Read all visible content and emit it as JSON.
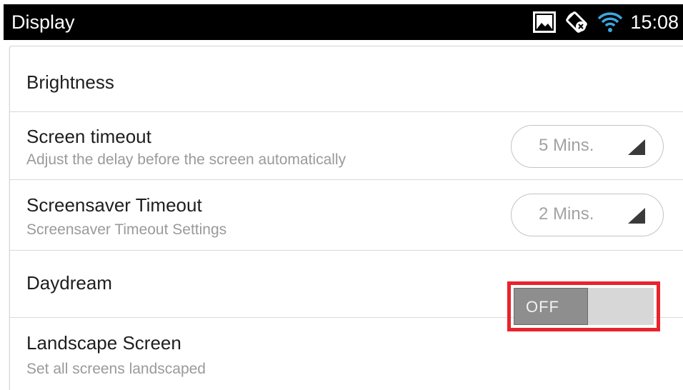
{
  "status_bar": {
    "title": "Display",
    "time": "15:08",
    "icons": [
      "image-notification-icon",
      "auto-rotate-off-icon",
      "wifi-icon"
    ]
  },
  "settings": {
    "brightness": {
      "title": "Brightness"
    },
    "screen_timeout": {
      "title": "Screen timeout",
      "subtitle": "Adjust the delay before the screen automatically",
      "value": "5 Mins."
    },
    "screensaver_timeout": {
      "title": "Screensaver Timeout",
      "subtitle": "Screensaver Timeout Settings",
      "value": "2 Mins."
    },
    "daydream": {
      "title": "Daydream"
    },
    "landscape_screen": {
      "title": "Landscape Screen",
      "subtitle": "Set all screens landscaped",
      "toggle_label": "OFF",
      "enabled": false
    }
  },
  "colors": {
    "status_bar_bg": "#000000",
    "highlight_border": "#e8232b",
    "switch_thumb": "#8e8e8e",
    "switch_track": "#d7d7d7"
  }
}
